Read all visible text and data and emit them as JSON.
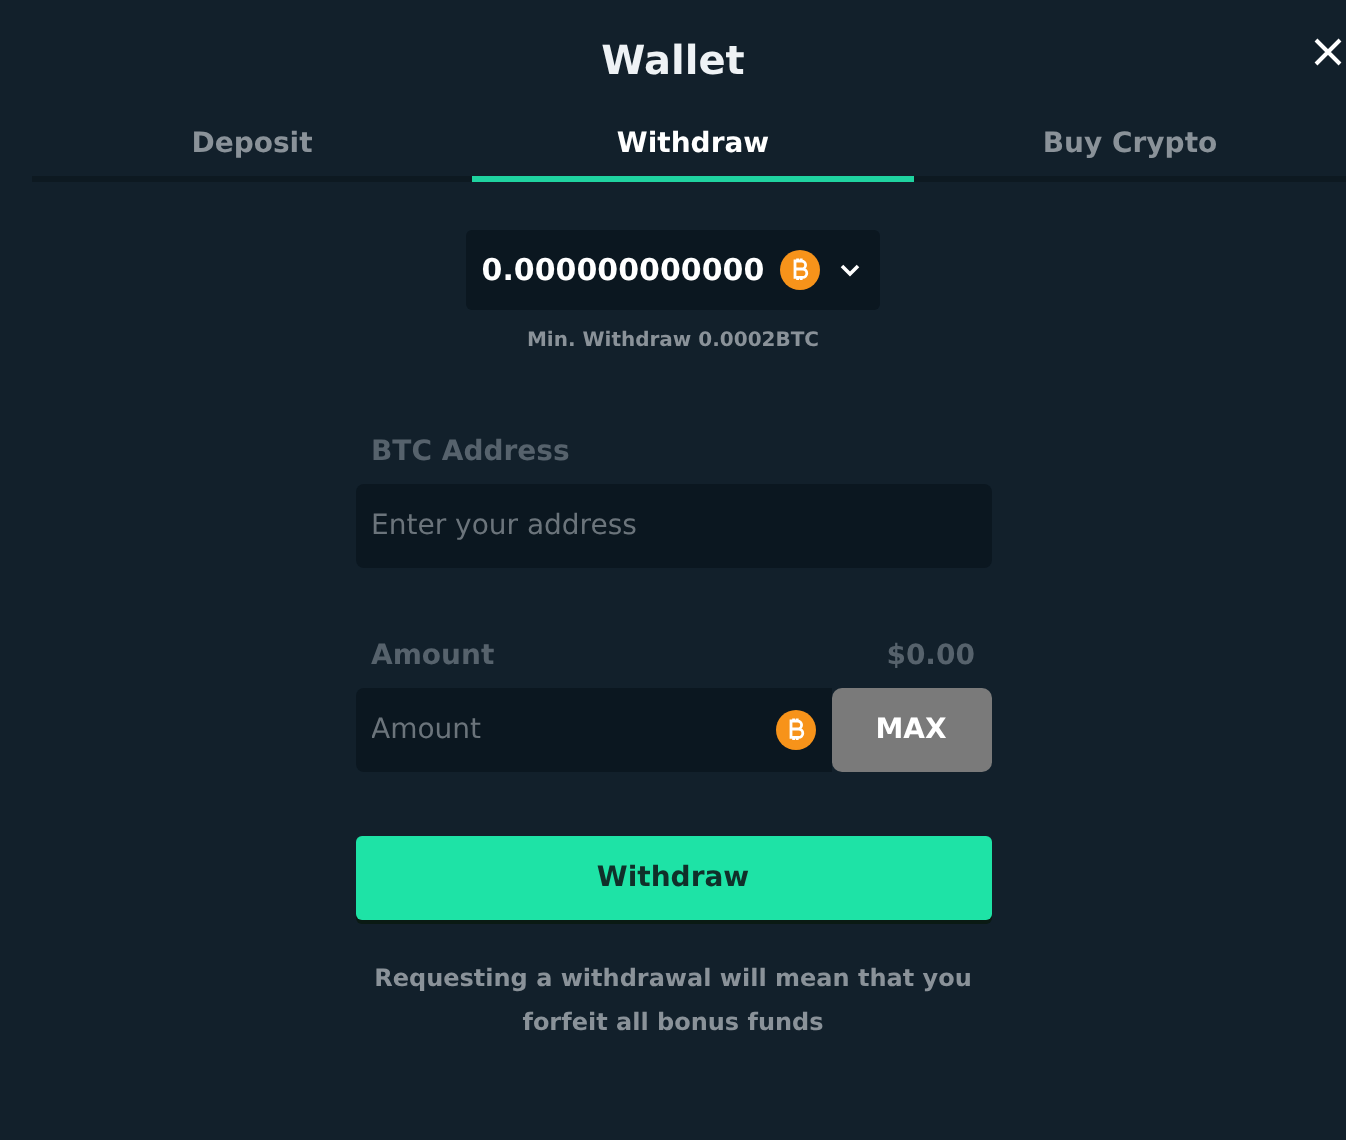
{
  "window": {
    "title": "Wallet"
  },
  "tabs": [
    {
      "label": "Deposit",
      "selected": false
    },
    {
      "label": "Withdraw",
      "selected": true
    },
    {
      "label": "Buy Crypto",
      "selected": false
    }
  ],
  "balance": {
    "value": "0.000000000000"
  },
  "min_withdraw": "Min. Withdraw 0.0002BTC",
  "address": {
    "label": "BTC Address",
    "placeholder": "Enter your address"
  },
  "amount": {
    "label": "Amount",
    "usd": "$0.00",
    "placeholder": "Amount",
    "max_button": "MAX"
  },
  "submit": "Withdraw",
  "note": "Requesting a withdrawal will mean that you forfeit all bonus funds"
}
